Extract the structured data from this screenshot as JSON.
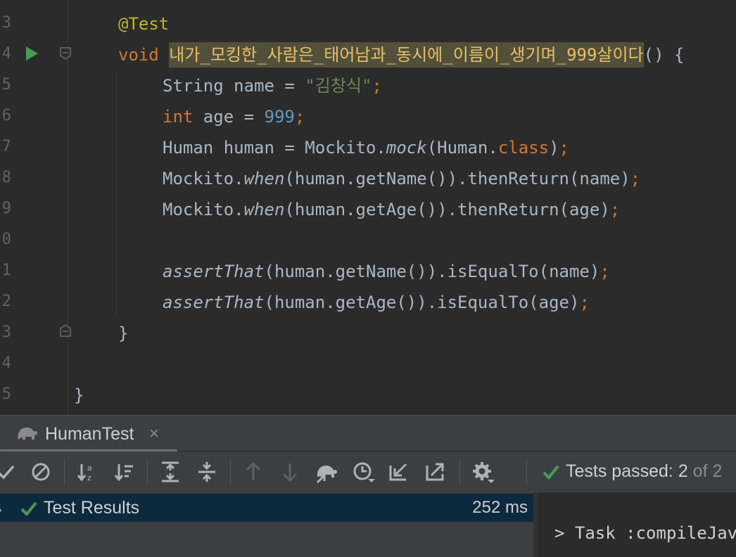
{
  "editor": {
    "lines": [
      {
        "number": "3"
      },
      {
        "number": "4"
      },
      {
        "number": "5"
      },
      {
        "number": "6"
      },
      {
        "number": "7"
      },
      {
        "number": "8"
      },
      {
        "number": "9"
      },
      {
        "number": "0"
      },
      {
        "number": "1"
      },
      {
        "number": "2"
      },
      {
        "number": "3"
      },
      {
        "number": "4"
      },
      {
        "number": "5"
      }
    ],
    "annotation": "@Test",
    "void_kw": "void",
    "method_name": "내가_모킹한_사람은_태어남과_동시에_이름이_생기며_999살이다",
    "method_tail": "() {",
    "l15": {
      "a": "String name = ",
      "b": "\"김창식\"",
      "c": ";"
    },
    "l16": {
      "a": "int",
      "b": " age = ",
      "c": "999",
      "d": ";"
    },
    "l17": {
      "a": "Human human = Mockito.",
      "b": "mock",
      "c": "(Human.",
      "d": "class",
      "e": ")",
      "f": ";"
    },
    "l18": {
      "a": "Mockito.",
      "b": "when",
      "c": "(human.getName()).thenReturn(name)",
      "d": ";"
    },
    "l19": {
      "a": "Mockito.",
      "b": "when",
      "c": "(human.getAge()).thenReturn(age)",
      "d": ";"
    },
    "l21": {
      "a": "assertThat",
      "b": "(human.getName()).isEqualTo(name)",
      "c": ";"
    },
    "l22": {
      "a": "assertThat",
      "b": "(human.getAge()).isEqualTo(age)",
      "c": ";"
    },
    "close_method": "}",
    "close_class": "}"
  },
  "run_panel": {
    "tab_label": "HumanTest",
    "tab_close": "×",
    "status_prefix": "Tests passed: ",
    "status_count": "2",
    "status_suffix": " of 2",
    "tree_label": "Test Results",
    "tree_time": "252 ms",
    "console_text": "> Task :compileJava"
  },
  "colors": {
    "pass": "#499c54",
    "editor_bg": "#2b2b2b",
    "panel_bg": "#3c3f41",
    "selected_row": "#0d293e"
  },
  "icons": [
    "run-test-icon",
    "fold-icon",
    "gradle-elephant-icon",
    "check-icon",
    "stop-icon",
    "sort-alpha-icon",
    "sort-duration-icon",
    "expand-all-icon",
    "collapse-all-icon",
    "arrow-up-icon",
    "arrow-down-icon",
    "import-tests-icon",
    "history-icon",
    "export-in-icon",
    "export-out-icon",
    "gear-icon",
    "test-passed-icon"
  ]
}
